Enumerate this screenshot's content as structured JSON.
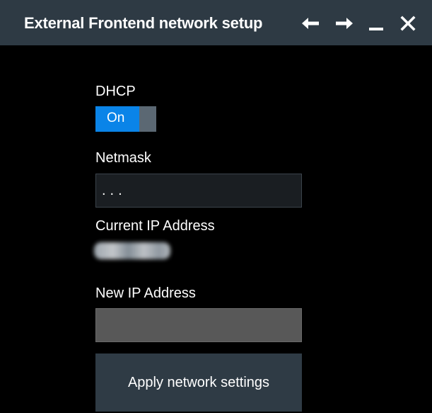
{
  "window": {
    "title": "External Frontend network setup"
  },
  "titlebar_buttons": {
    "back_icon": "arrow-left-icon",
    "forward_icon": "arrow-right-icon",
    "minimize_icon": "minimize-icon",
    "close_icon": "close-icon"
  },
  "dhcp": {
    "label": "DHCP",
    "toggle_state": "On"
  },
  "netmask": {
    "label": "Netmask",
    "value": "..."
  },
  "current_ip": {
    "label": "Current IP Address"
  },
  "new_ip": {
    "label": "New IP Address",
    "value": ""
  },
  "actions": {
    "apply_label": "Apply network settings"
  },
  "colors": {
    "titlebar": "#2e3a44",
    "background": "#000000",
    "toggle_on": "#0a84e8",
    "button": "#2f3b45"
  }
}
